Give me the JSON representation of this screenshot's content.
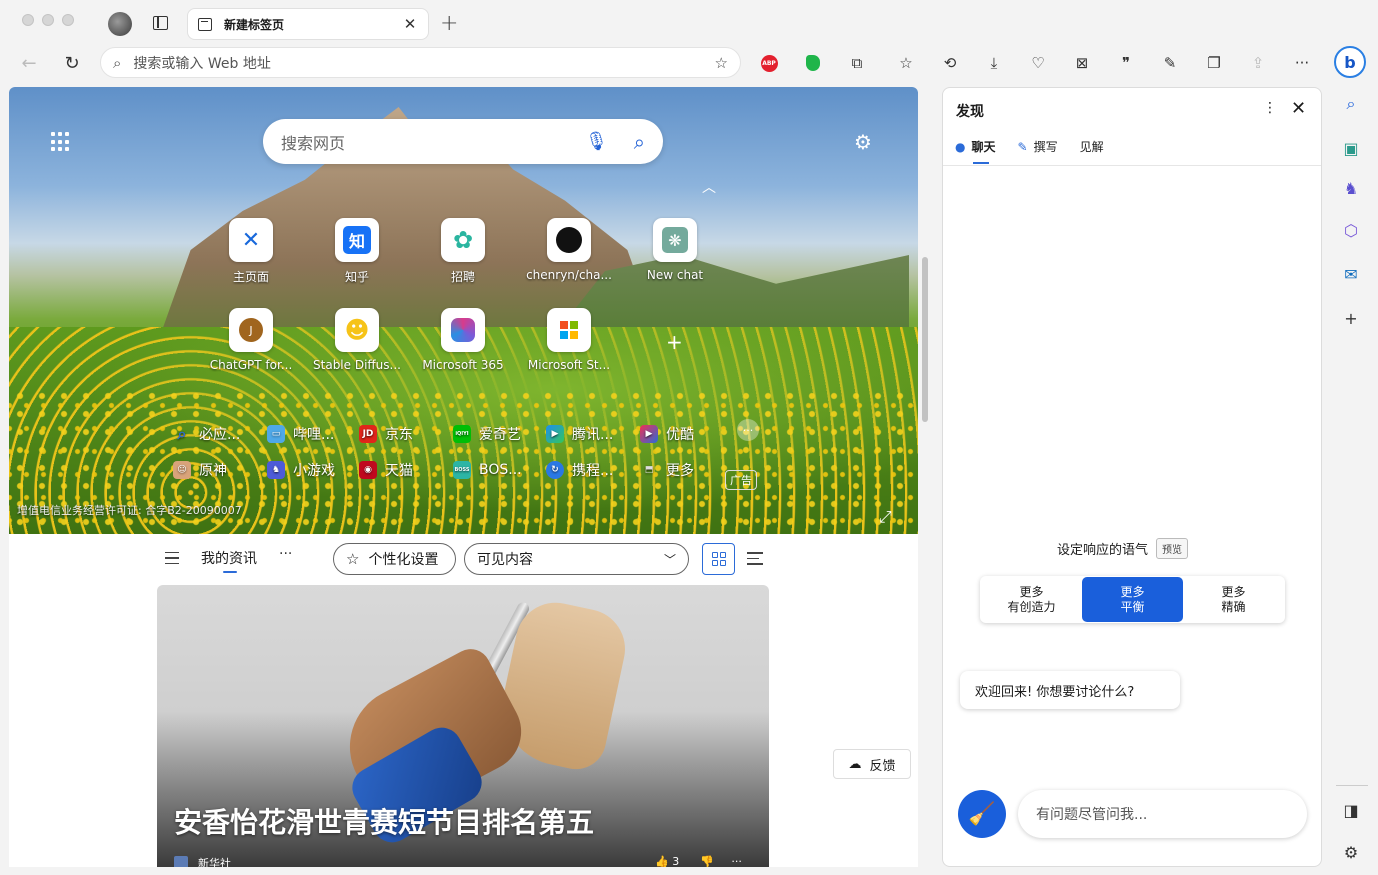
{
  "tab": {
    "title": "新建标签页",
    "close": "✕",
    "new": "+"
  },
  "address": {
    "placeholder": "搜索或输入 Web 地址"
  },
  "toolbar": {
    "abp_label": "ABP",
    "more": "···"
  },
  "search": {
    "placeholder": "搜索网页"
  },
  "tiles": [
    {
      "label": "主页面",
      "icon": "confluence-icon"
    },
    {
      "label": "知乎",
      "icon": "zhihu-icon",
      "glyph": "知"
    },
    {
      "label": "招聘",
      "icon": "recruit-icon"
    },
    {
      "label": "chenryn/cha...",
      "icon": "github-icon"
    },
    {
      "label": "New chat",
      "icon": "openai-icon"
    },
    {
      "label": "ChatGPT for...",
      "icon": "chatgpt-icon",
      "glyph": "J"
    },
    {
      "label": "Stable Diffus...",
      "icon": "huggingface-icon"
    },
    {
      "label": "Microsoft 365",
      "icon": "m365-icon"
    },
    {
      "label": "Microsoft St...",
      "icon": "msstore-icon"
    }
  ],
  "quicklinks": [
    {
      "label": "必应...",
      "color": "#2b6bd8"
    },
    {
      "label": "哔哩...",
      "color": "#4fa8e8"
    },
    {
      "label": "京东",
      "color": "#e1251b",
      "glyph": "JD"
    },
    {
      "label": "爱奇艺",
      "color": "#00be06",
      "glyph": "iQIYI"
    },
    {
      "label": "腾讯...",
      "color": "#1d8df2"
    },
    {
      "label": "优酷",
      "color": "#f12f54"
    },
    {
      "label": "原神",
      "color": "#d9a37a"
    },
    {
      "label": "小游戏",
      "color": "#4d5bd8"
    },
    {
      "label": "天猫",
      "color": "#c0081e"
    },
    {
      "label": "BOS...",
      "color": "#2cb5a5",
      "glyph": "BOSS"
    },
    {
      "label": "携程...",
      "color": "#2a78e4"
    },
    {
      "label": "更多",
      "color": "#777"
    }
  ],
  "ad_label": "广告",
  "license": "增值电信业务经营许可证: 合字B2-20090007",
  "feed": {
    "my_feed": "我的资讯",
    "more": "···",
    "personalize": "个性化设置",
    "visible_content": "可见内容",
    "headline": "安香怡花滑世青赛短节目排名第五",
    "source": "新华社",
    "likes": "3",
    "feedback": "反馈"
  },
  "discover": {
    "title": "发现",
    "tabs": [
      "聊天",
      "撰写",
      "见解"
    ],
    "tone_label": "设定响应的语气",
    "preview": "预览",
    "tones": [
      {
        "line1": "更多",
        "line2": "有创造力"
      },
      {
        "line1": "更多",
        "line2": "平衡"
      },
      {
        "line1": "更多",
        "line2": "精确"
      }
    ],
    "welcome": "欢迎回来! 你想要讨论什么?",
    "ask_placeholder": "有问题尽管问我..."
  },
  "colors": {
    "accent": "#1a5fdb",
    "bing": "#2a7fe3"
  }
}
